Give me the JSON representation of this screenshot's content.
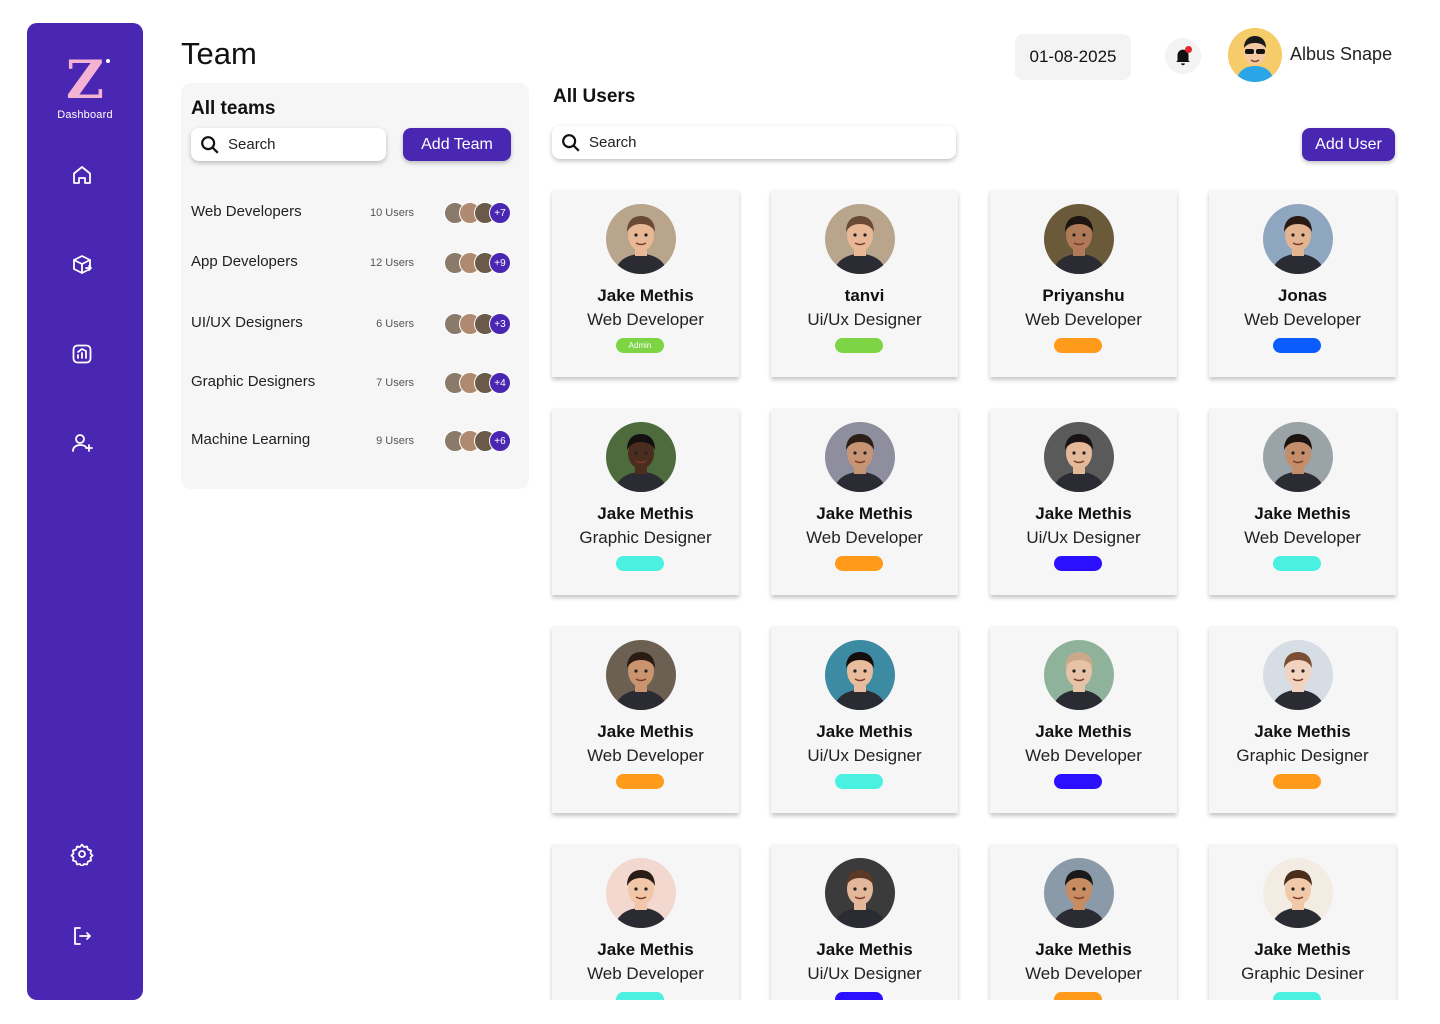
{
  "sidebar": {
    "logo_text": "Z",
    "logo_label": "Dashboard",
    "icons": [
      "home-icon",
      "package-icon",
      "analytics-icon",
      "add-user-icon",
      "settings-icon",
      "logout-icon"
    ]
  },
  "header": {
    "title": "Team",
    "date": "01-08-2025",
    "user_name": "Albus Snape"
  },
  "teams": {
    "title": "All teams",
    "search_placeholder": "Search",
    "add_button": "Add Team",
    "list": [
      {
        "name": "Web Developers",
        "count": "10 Users",
        "more": "+7"
      },
      {
        "name": "App Developers",
        "count": "12 Users",
        "more": "+9"
      },
      {
        "name": "UI/UX Designers",
        "count": "6 Users",
        "more": "+3"
      },
      {
        "name": "Graphic Designers",
        "count": "7 Users",
        "more": "+4"
      },
      {
        "name": "Machine Learning",
        "count": "9 Users",
        "more": "+6"
      }
    ]
  },
  "users": {
    "title": "All Users",
    "search_placeholder": "Search",
    "add_button": "Add User",
    "cards": [
      {
        "name": "Jake Methis",
        "role": "Web Developer",
        "badge": "Admin",
        "color": "#7dd444",
        "skin": "#e8b896",
        "hair": "#6b4a33",
        "bg": "#b9a58c"
      },
      {
        "name": "tanvi",
        "role": "Ui/Ux Designer",
        "badge": "",
        "color": "#7dd444",
        "skin": "#e8b896",
        "hair": "#6b4a33",
        "bg": "#b9a58c"
      },
      {
        "name": "Priyanshu",
        "role": "Web Developer",
        "badge": "",
        "color": "#ff9a1a",
        "skin": "#b07a58",
        "hair": "#1d1512",
        "bg": "#6a5a3a"
      },
      {
        "name": "Jonas",
        "role": "Web Developer",
        "badge": "",
        "color": "#0a5cff",
        "skin": "#e2b48f",
        "hair": "#2a1a12",
        "bg": "#8fa6c0"
      },
      {
        "name": "Jake Methis",
        "role": "Graphic Designer",
        "badge": "",
        "color": "#4af0e0",
        "skin": "#4a2d1e",
        "hair": "#141010",
        "bg": "#4d6b3d"
      },
      {
        "name": "Jake Methis",
        "role": "Web Developer",
        "badge": "",
        "color": "#ff9a1a",
        "skin": "#c79474",
        "hair": "#2b1f18",
        "bg": "#8e8e9e"
      },
      {
        "name": "Jake Methis",
        "role": "Ui/Ux Designer",
        "badge": "",
        "color": "#2a10ff",
        "skin": "#e3b999",
        "hair": "#1a1414",
        "bg": "#5a5a5a"
      },
      {
        "name": "Jake Methis",
        "role": "Web Developer",
        "badge": "",
        "color": "#4af0e0",
        "skin": "#c48e6b",
        "hair": "#1c1410",
        "bg": "#9aa3a8"
      },
      {
        "name": "Jake Methis",
        "role": "Web Developer",
        "badge": "",
        "color": "#ff9a1a",
        "skin": "#c9946e",
        "hair": "#2a1c14",
        "bg": "#6b6052"
      },
      {
        "name": "Jake Methis",
        "role": "Ui/Ux Designer",
        "badge": "",
        "color": "#4af0e0",
        "skin": "#e8bc9c",
        "hair": "#140e0c",
        "bg": "#3d8aa3"
      },
      {
        "name": "Jake Methis",
        "role": "Web Developer",
        "badge": "",
        "color": "#2a10ff",
        "skin": "#e6c3a6",
        "hair": "#c9a98a",
        "bg": "#8fb39a"
      },
      {
        "name": "Jake Methis",
        "role": "Graphic Designer",
        "badge": "",
        "color": "#ff9a1a",
        "skin": "#f2d3c0",
        "hair": "#7a4e33",
        "bg": "#d6dde4"
      },
      {
        "name": "Jake Methis",
        "role": "Web Developer",
        "badge": "",
        "color": "#4af0e0",
        "skin": "#f0c7a8",
        "hair": "#2a1c16",
        "bg": "#f3d8cf"
      },
      {
        "name": "Jake Methis",
        "role": "Ui/Ux Designer",
        "badge": "",
        "color": "#2a10ff",
        "skin": "#e3b79a",
        "hair": "#5a3a26",
        "bg": "#3b3b3b"
      },
      {
        "name": "Jake Methis",
        "role": "Web Developer",
        "badge": "",
        "color": "#ff9a1a",
        "skin": "#c78c62",
        "hair": "#1a1a1a",
        "bg": "#8a9aa8"
      },
      {
        "name": "Jake Methis",
        "role": "Graphic Desiner",
        "badge": "",
        "color": "#4af0e0",
        "skin": "#f0c9a8",
        "hair": "#4a2e1c",
        "bg": "#f3ece3"
      }
    ]
  }
}
